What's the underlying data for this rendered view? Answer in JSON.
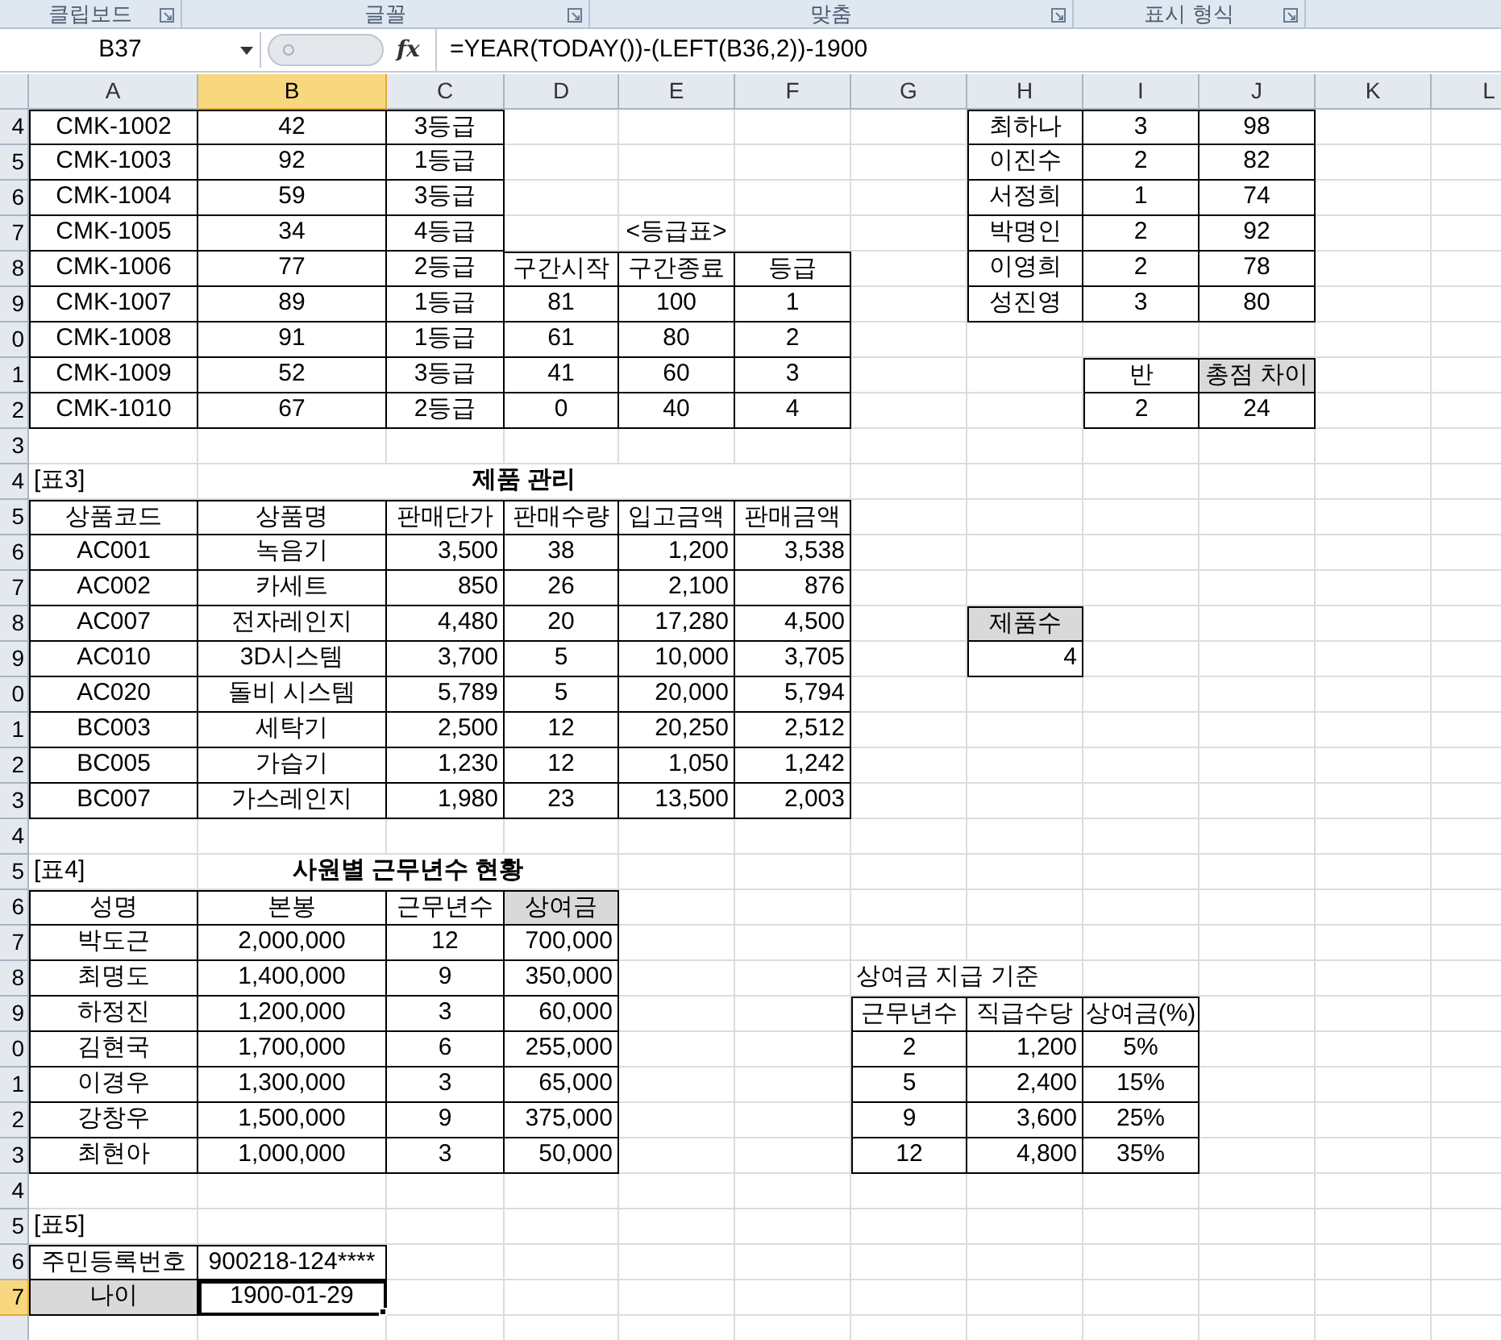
{
  "ribbon_groups": [
    {
      "label": "클립보드"
    },
    {
      "label": "글꼴"
    },
    {
      "label": "맞춤"
    },
    {
      "label": "표시 형식"
    }
  ],
  "formula_bar": {
    "name_box": "B37",
    "fx": "fx",
    "formula": "=YEAR(TODAY())-(LEFT(B36,2))-1900"
  },
  "columns": [
    {
      "label": "A",
      "selected": false
    },
    {
      "label": "B",
      "selected": true
    },
    {
      "label": "C",
      "selected": false
    },
    {
      "label": "D",
      "selected": false
    },
    {
      "label": "E",
      "selected": false
    },
    {
      "label": "F",
      "selected": false
    },
    {
      "label": "G",
      "selected": false
    },
    {
      "label": "H",
      "selected": false
    },
    {
      "label": "I",
      "selected": false
    },
    {
      "label": "J",
      "selected": false
    },
    {
      "label": "K",
      "selected": false
    },
    {
      "label": "L",
      "selected": false
    }
  ],
  "rows": [
    {
      "header": "4",
      "selected": false,
      "cells": {
        "A": "CMK-1002",
        "B": "42",
        "C": "3등급",
        "H": "최하나",
        "I": "3",
        "J": "98"
      }
    },
    {
      "header": "5",
      "selected": false,
      "cells": {
        "A": "CMK-1003",
        "B": "92",
        "C": "1등급",
        "H": "이진수",
        "I": "2",
        "J": "82"
      }
    },
    {
      "header": "6",
      "selected": false,
      "cells": {
        "A": "CMK-1004",
        "B": "59",
        "C": "3등급",
        "H": "서정희",
        "I": "1",
        "J": "74"
      }
    },
    {
      "header": "7",
      "selected": false,
      "cells": {
        "A": "CMK-1005",
        "B": "34",
        "C": "4등급",
        "E": "<등급표>",
        "H": "박명인",
        "I": "2",
        "J": "92"
      }
    },
    {
      "header": "8",
      "selected": false,
      "cells": {
        "A": "CMK-1006",
        "B": "77",
        "C": "2등급",
        "D": "구간시작",
        "E": "구간종료",
        "F": "등급",
        "H": "이영희",
        "I": "2",
        "J": "78"
      }
    },
    {
      "header": "9",
      "selected": false,
      "cells": {
        "A": "CMK-1007",
        "B": "89",
        "C": "1등급",
        "D": "81",
        "E": "100",
        "F": "1",
        "H": "성진영",
        "I": "3",
        "J": "80"
      }
    },
    {
      "header": "0",
      "selected": false,
      "cells": {
        "A": "CMK-1008",
        "B": "91",
        "C": "1등급",
        "D": "61",
        "E": "80",
        "F": "2"
      }
    },
    {
      "header": "1",
      "selected": false,
      "cells": {
        "A": "CMK-1009",
        "B": "52",
        "C": "3등급",
        "D": "41",
        "E": "60",
        "F": "3",
        "I": "반",
        "J": {
          "text": "총점 차이",
          "shaded": true
        }
      }
    },
    {
      "header": "2",
      "selected": false,
      "cells": {
        "A": "CMK-1010",
        "B": "67",
        "C": "2등급",
        "D": "0",
        "E": "40",
        "F": "4",
        "I": "2",
        "J": "24"
      }
    },
    {
      "header": "3",
      "selected": false,
      "cells": {}
    },
    {
      "header": "4",
      "selected": false,
      "cells": {
        "A": {
          "text": "[표3]",
          "kind": "label"
        },
        "B": {
          "text": "제품 관리",
          "kind": "title"
        }
      }
    },
    {
      "header": "5",
      "selected": false,
      "cells": {
        "A": "상품코드",
        "B": "상품명",
        "C": "판매단가",
        "D": "판매수량",
        "E": "입고금액",
        "F": "판매금액"
      }
    },
    {
      "header": "6",
      "selected": false,
      "cells": {
        "A": "AC001",
        "B": "녹음기",
        "C": "3,500",
        "D": "38",
        "E": "1,200",
        "F": "3,538"
      }
    },
    {
      "header": "7",
      "selected": false,
      "cells": {
        "A": "AC002",
        "B": "카세트",
        "C": "850",
        "D": "26",
        "E": "2,100",
        "F": "876"
      }
    },
    {
      "header": "8",
      "selected": false,
      "cells": {
        "A": "AC007",
        "B": "전자레인지",
        "C": "4,480",
        "D": "20",
        "E": "17,280",
        "F": "4,500",
        "H": {
          "text": "제품수",
          "shaded": true
        }
      }
    },
    {
      "header": "9",
      "selected": false,
      "cells": {
        "A": "AC010",
        "B": "3D시스템",
        "C": "3,700",
        "D": "5",
        "E": "10,000",
        "F": "3,705",
        "H": "4"
      }
    },
    {
      "header": "0",
      "selected": false,
      "cells": {
        "A": "AC020",
        "B": "돌비 시스템",
        "C": "5,789",
        "D": "5",
        "E": "20,000",
        "F": "5,794"
      }
    },
    {
      "header": "1",
      "selected": false,
      "cells": {
        "A": "BC003",
        "B": "세탁기",
        "C": "2,500",
        "D": "12",
        "E": "20,250",
        "F": "2,512"
      }
    },
    {
      "header": "2",
      "selected": false,
      "cells": {
        "A": "BC005",
        "B": "가습기",
        "C": "1,230",
        "D": "12",
        "E": "1,050",
        "F": "1,242"
      }
    },
    {
      "header": "3",
      "selected": false,
      "cells": {
        "A": "BC007",
        "B": "가스레인지",
        "C": "1,980",
        "D": "23",
        "E": "13,500",
        "F": "2,003"
      }
    },
    {
      "header": "4",
      "selected": false,
      "cells": {}
    },
    {
      "header": "5",
      "selected": false,
      "cells": {
        "A": {
          "text": "[표4]",
          "kind": "label"
        },
        "B": {
          "text": "사원별 근무년수 현황",
          "kind": "title"
        }
      }
    },
    {
      "header": "6",
      "selected": false,
      "cells": {
        "A": "성명",
        "B": "본봉",
        "C": "근무년수",
        "D": {
          "text": "상여금",
          "shaded": true
        }
      }
    },
    {
      "header": "7",
      "selected": false,
      "cells": {
        "A": "박도근",
        "B": "2,000,000",
        "C": "12",
        "D": "700,000"
      }
    },
    {
      "header": "8",
      "selected": false,
      "cells": {
        "A": "최명도",
        "B": "1,400,000",
        "C": "9",
        "D": "350,000",
        "G": {
          "text": "상여금 지급 기준",
          "kind": "caption"
        }
      }
    },
    {
      "header": "9",
      "selected": false,
      "cells": {
        "A": "하정진",
        "B": "1,200,000",
        "C": "3",
        "D": "60,000",
        "G": "근무년수",
        "H": "직급수당",
        "I": "상여금(%)"
      }
    },
    {
      "header": "0",
      "selected": false,
      "cells": {
        "A": "김현국",
        "B": "1,700,000",
        "C": "6",
        "D": "255,000",
        "G": "2",
        "H": "1,200",
        "I": "5%"
      }
    },
    {
      "header": "1",
      "selected": false,
      "cells": {
        "A": "이경우",
        "B": "1,300,000",
        "C": "3",
        "D": "65,000",
        "G": "5",
        "H": "2,400",
        "I": "15%"
      }
    },
    {
      "header": "2",
      "selected": false,
      "cells": {
        "A": "강창우",
        "B": "1,500,000",
        "C": "9",
        "D": "375,000",
        "G": "9",
        "H": "3,600",
        "I": "25%"
      }
    },
    {
      "header": "3",
      "selected": false,
      "cells": {
        "A": "최현아",
        "B": "1,000,000",
        "C": "3",
        "D": "50,000",
        "G": "12",
        "H": "4,800",
        "I": "35%"
      }
    },
    {
      "header": "4",
      "selected": false,
      "cells": {}
    },
    {
      "header": "5",
      "selected": false,
      "cells": {
        "A": {
          "text": "[표5]",
          "kind": "label"
        }
      }
    },
    {
      "header": "6",
      "selected": false,
      "cells": {
        "A": "주민등록번호",
        "B": "900218-124****"
      }
    },
    {
      "header": "7",
      "selected": true,
      "cells": {
        "A": {
          "text": "나이",
          "shaded": true
        },
        "B": {
          "text": "1900-01-29",
          "selected": true
        }
      }
    }
  ]
}
